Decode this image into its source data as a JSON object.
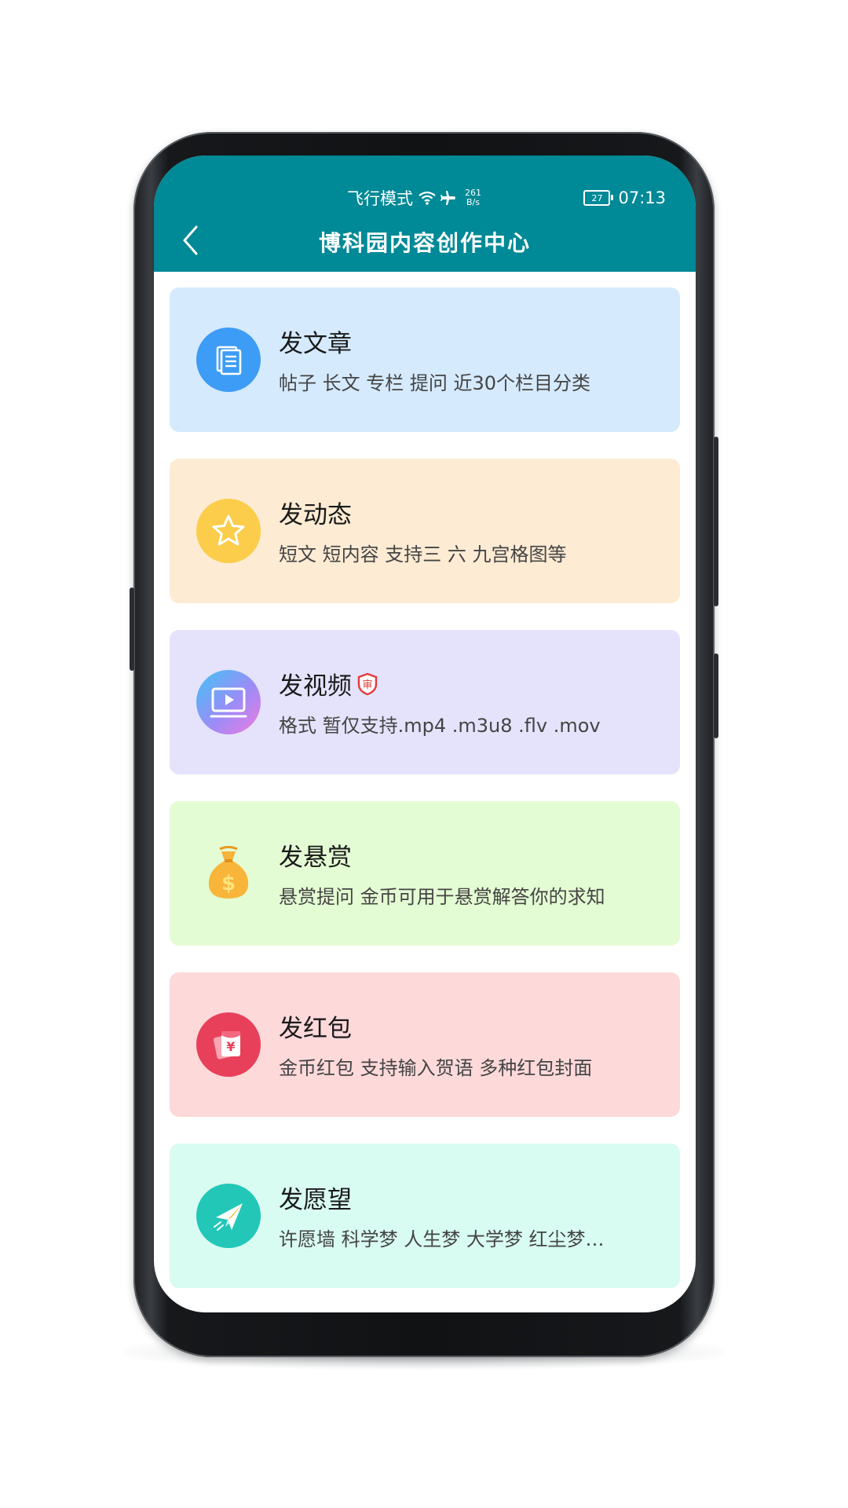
{
  "status_bar": {
    "airplane_mode": "飞行模式",
    "net_speed_value": "261",
    "net_speed_unit": "B/s",
    "battery_level": "27",
    "time": "07:13"
  },
  "header": {
    "back_icon": "chevron-left-icon",
    "title": "博科园内容创作中心",
    "color": "#008996"
  },
  "cards": [
    {
      "title": "发文章",
      "desc": "帖子 长文 专栏 提问 近30个栏目分类",
      "bg": "#d5eafd",
      "icon": "document-icon"
    },
    {
      "title": "发动态",
      "desc": "短文 短内容 支持三 六 九宫格图等",
      "bg": "#fdebd3",
      "icon": "star-icon"
    },
    {
      "title": "发视频",
      "badge": "审",
      "desc": "格式 暂仅支持.mp4 .m3u8 .flv .mov",
      "bg": "#e5e3fb",
      "icon": "video-play-icon"
    },
    {
      "title": "发悬赏",
      "desc": "悬赏提问 金币可用于悬赏解答你的求知",
      "bg": "#e4fcd3",
      "icon": "money-bag-icon"
    },
    {
      "title": "发红包",
      "desc": "金币红包 支持输入贺语 多种红包封面",
      "bg": "#fdd9da",
      "icon": "red-envelope-icon"
    },
    {
      "title": "发愿望",
      "desc": "许愿墙 科学梦 人生梦 大学梦 红尘梦…",
      "bg": "#d8fbf2",
      "icon": "paper-plane-icon"
    }
  ]
}
